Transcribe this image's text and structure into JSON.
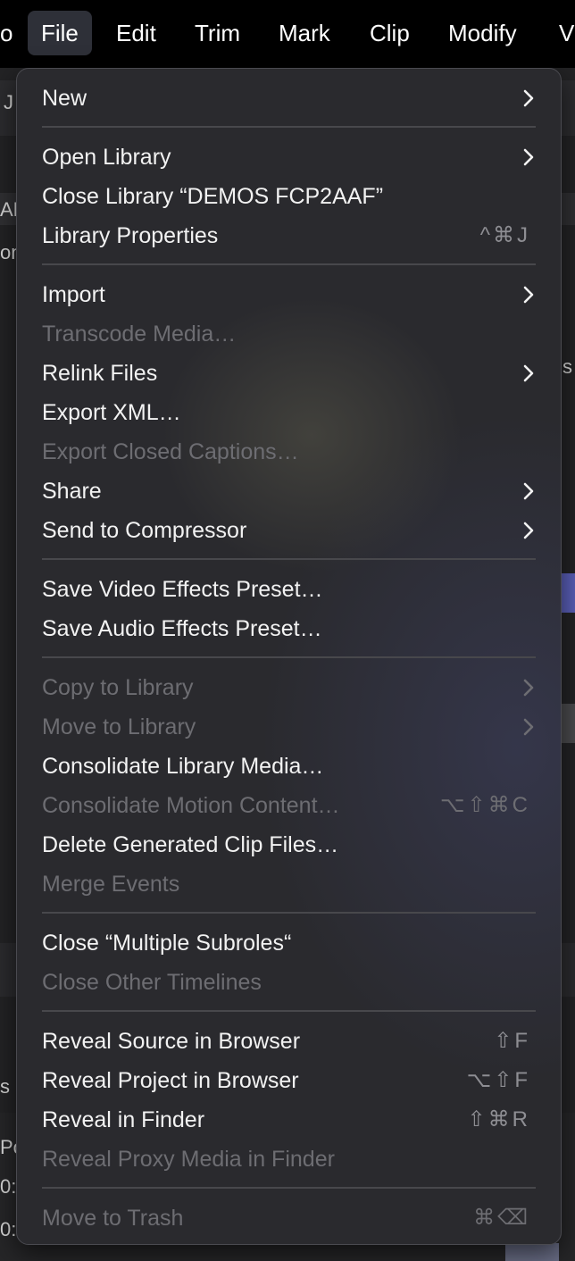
{
  "menubar": {
    "items": [
      {
        "label": "o"
      },
      {
        "label": "File"
      },
      {
        "label": "Edit"
      },
      {
        "label": "Trim"
      },
      {
        "label": "Mark"
      },
      {
        "label": "Clip"
      },
      {
        "label": "Modify"
      },
      {
        "label": "V"
      }
    ]
  },
  "background": {
    "fragments": [
      "J",
      "AF",
      "on",
      "s",
      "s",
      "Po",
      "0:",
      "0:"
    ]
  },
  "file_menu": {
    "items": [
      {
        "label": "New",
        "submenu": true,
        "enabled": true
      },
      {
        "label": "Open Library",
        "submenu": true,
        "enabled": true
      },
      {
        "label": "Close Library “DEMOS FCP2AAF”",
        "enabled": true
      },
      {
        "label": "Library Properties",
        "shortcut": "^⌘J",
        "enabled": true
      },
      {
        "label": "Import",
        "submenu": true,
        "enabled": true
      },
      {
        "label": "Transcode Media…",
        "enabled": false
      },
      {
        "label": "Relink Files",
        "submenu": true,
        "enabled": true
      },
      {
        "label": "Export XML…",
        "enabled": true
      },
      {
        "label": "Export Closed Captions…",
        "enabled": false
      },
      {
        "label": "Share",
        "submenu": true,
        "enabled": true
      },
      {
        "label": "Send to Compressor",
        "submenu": true,
        "enabled": true
      },
      {
        "label": "Save Video Effects Preset…",
        "enabled": true
      },
      {
        "label": "Save Audio Effects Preset…",
        "enabled": true
      },
      {
        "label": "Copy to Library",
        "submenu": true,
        "enabled": false
      },
      {
        "label": "Move to Library",
        "submenu": true,
        "enabled": false
      },
      {
        "label": "Consolidate Library Media…",
        "enabled": true
      },
      {
        "label": "Consolidate Motion Content…",
        "shortcut": "⌥⇧⌘C",
        "enabled": false
      },
      {
        "label": "Delete Generated Clip Files…",
        "enabled": true
      },
      {
        "label": "Merge Events",
        "enabled": false
      },
      {
        "label": "Close “Multiple Subroles“",
        "enabled": true
      },
      {
        "label": "Close Other Timelines",
        "enabled": false
      },
      {
        "label": "Reveal Source in Browser",
        "shortcut": "⇧F",
        "enabled": true
      },
      {
        "label": "Reveal Project in Browser",
        "shortcut": "⌥⇧F",
        "enabled": true
      },
      {
        "label": "Reveal in Finder",
        "shortcut": "⇧⌘R",
        "enabled": true
      },
      {
        "label": "Reveal Proxy Media in Finder",
        "enabled": false
      },
      {
        "label": "Move to Trash",
        "shortcut": "⌘⌫",
        "enabled": false
      }
    ]
  },
  "colors": {
    "menu_background": "#2a2a2e",
    "menubar_background": "#000000",
    "active_menu_highlight": "#2e3038",
    "enabled_text": "#f2f2f2",
    "disabled_text": "#6d6d72",
    "shortcut_text": "#8e8e93",
    "separator": "#48484c"
  }
}
